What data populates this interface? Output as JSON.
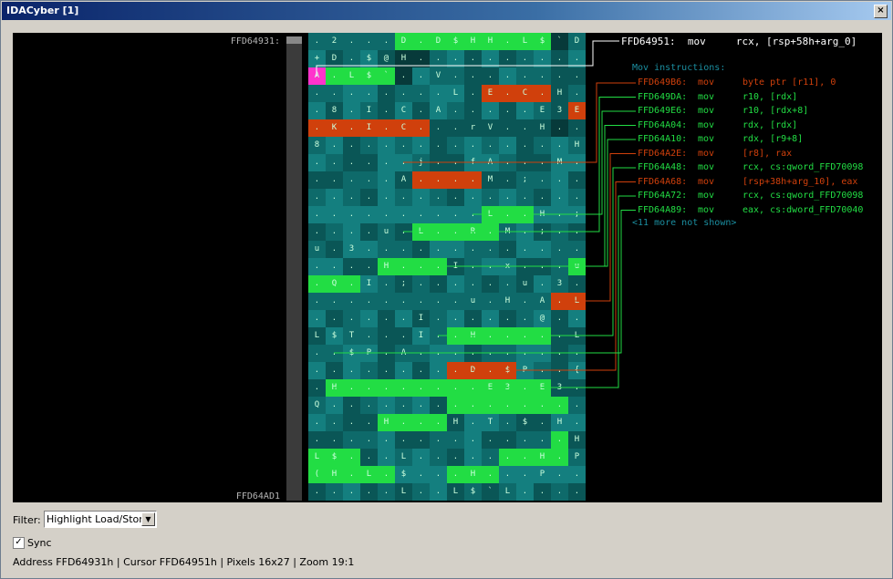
{
  "window": {
    "title": "IDACyber [1]",
    "close_glyph": "×"
  },
  "view": {
    "address_top": "FFD64931:",
    "address_bottom": "FFD64AD1",
    "main_instruction": "FFD64951:  mov     rcx, [rsp+58h+arg_0]",
    "mov_title": "Mov instructions:",
    "more_text": "<11 more not shown>",
    "instructions": [
      {
        "addr": "FFD649B6:",
        "mn": "mov",
        "op": "byte ptr [r11], 0",
        "kind": "store"
      },
      {
        "addr": "FFD649DA:",
        "mn": "mov",
        "op": "r10, [rdx]",
        "kind": "load"
      },
      {
        "addr": "FFD649E6:",
        "mn": "mov",
        "op": "r10, [rdx+8]",
        "kind": "load"
      },
      {
        "addr": "FFD64A04:",
        "mn": "mov",
        "op": "rdx, [rdx]",
        "kind": "load"
      },
      {
        "addr": "FFD64A10:",
        "mn": "mov",
        "op": "rdx, [r9+8]",
        "kind": "load"
      },
      {
        "addr": "FFD64A2E:",
        "mn": "mov",
        "op": "[r8], rax",
        "kind": "store"
      },
      {
        "addr": "FFD64A48:",
        "mn": "mov",
        "op": "rcx, cs:qword_FFD70098",
        "kind": "load"
      },
      {
        "addr": "FFD64A68:",
        "mn": "mov",
        "op": "[rsp+38h+arg_10], eax",
        "kind": "store"
      },
      {
        "addr": "FFD64A72:",
        "mn": "mov",
        "op": "rcx, cs:qword_FFD70098",
        "kind": "load"
      },
      {
        "addr": "FFD64A89:",
        "mn": "mov",
        "op": "eax, cs:dword_FFD70040",
        "kind": "load"
      }
    ],
    "grid_rows": [
      ". 2 . . . D . D $ H H . L $ ` D",
      "+ D . $ @ H . . . . . . . . . .",
      "A . L $ ` . . V . . . . . . . .",
      ". . . . . . . . L . E . C . H .",
      ". 8 . I . C . A . . . . . E 3 E",
      ". K . I . C . . . r V . . H . .",
      "8 . . . . . . . . . . . . . . H",
      ". . . . . . j . . f A . . . M .",
      ". . . . . A . . . . M . ; . . .",
      ". . . . . . . . . . . . . . . .",
      ". . . . . . . . . . L . . H . ;",
      ". . . . u . L . . R . M . ; . .",
      "u . 3 . . . . . . . . . . . . .",
      ". . . . H . . . I . . x . . . u",
      ". Q . I . ; . . . . . . u . 3 .",
      ". . . . . . . . . u . H . A . L",
      ". . . . . . I . . . . . . @ . .",
      "L $ T . . . I . . H . . . . . L",
      ". . $ P . A . . . . . . . . . .",
      ". . . . . . . . . D . $ P . . {",
      ". H . . . . . . . . E 3 . E 3 .",
      "Q . . . . . . . . . . . . . . .",
      ". . . . H . . . H . T . $ . H .",
      ". . . . . . . . . . . . . . . H",
      "L $ . . . L . . . . . . . H . P",
      "( H . L . $ . . . H . . . P . .",
      ". . . . . L . . L $ ` L . . . ."
    ],
    "grid_kinds": [
      "tttttgggggggggdt",
      "tttttddttttttttt",
      "pggggdtttttttttt",
      "ttttttttttrrrrtt",
      "tttttttttttttttr",
      "rrrrrrrtttttttdt",
      "tttttttttttttttt",
      "tttttttttttttttt",
      "ttttttrrrrtttttt",
      "tttttttttttttttt",
      "ttttttttttgggttt",
      "ttttttgggggttttt",
      "tttttttttttttttt",
      "ttttggggtttttttg",
      "gggttttttttttttt",
      "ttttttttttttttrrr",
      "tttttttttttttttt",
      "ttttttttggggggtt",
      "tttttttttttttttt",
      "ttttttttrrrrtttt",
      "tgggggggggggggtt",
      "ttttttttgggggggt",
      "ttttggggtttttttt",
      "ttttttttttttttgt",
      "gggttttttttggggt",
      "gggggtttgggttttt",
      "tttttttttttttttt"
    ]
  },
  "colors": {
    "load": "#22dd44",
    "store": "#d0400c",
    "teal_a": "#0e6a6a",
    "teal_b": "#147f7f",
    "teal_c": "#0a5656",
    "cursor": "#ff33cc",
    "dark": "#073a3a"
  },
  "filter": {
    "label": "Filter:",
    "value": "Highlight Load/Store"
  },
  "sync": {
    "label": "Sync",
    "checked": true,
    "check_glyph": "✓"
  },
  "status_text": "Address FFD64931h | Cursor FFD64951h | Pixels 16x27  | Zoom 19:1"
}
